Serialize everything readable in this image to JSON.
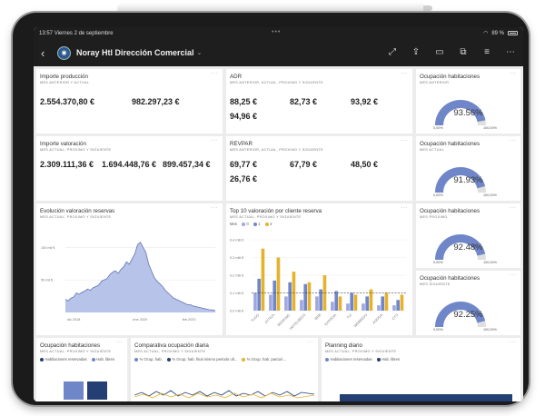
{
  "colors": {
    "accent": "#6f86c9",
    "gold": "#e5b22e",
    "navy": "#233f73",
    "lilac": "#9fa7de",
    "gaugeTrack": "#dfdfdf",
    "area": "#b7c3e8"
  },
  "statusbar": {
    "time": "13:57",
    "date": "Viernes 2 de septiembre",
    "battery": "89 %",
    "handle": "•••"
  },
  "appbar": {
    "title": "Noray Htl Dirección Comercial",
    "icons": [
      "back-icon",
      "expand-icon",
      "share-icon",
      "comment-icon",
      "present-icon",
      "list-icon",
      "more-icon"
    ]
  },
  "cards": {
    "importe_produccion": {
      "title": "Importe producción",
      "sub": "MES ANTERIOR Y ACTUAL",
      "v1": "2.554.370,80 €",
      "v2": "982.297,23 €"
    },
    "adr": {
      "title": "ADR",
      "sub": "MES ANTERIOR, ACTUAL, PROXIMO Y SIGUIENTE",
      "v1": "88,25 €",
      "v2": "82,73 €",
      "v3": "93,92 €",
      "v4": "94,96 €"
    },
    "importe_valoracion": {
      "title": "Importe valoración",
      "sub": "MES ACTUAL, PROXIMO Y SIGUIENTE",
      "v1": "2.309.111,36 €",
      "v2": "1.694.448,76 €",
      "v3": "899.457,34 €"
    },
    "revpar": {
      "title": "REVPAR",
      "sub": "MES ANTERIOR, ACTUAL, PROXIMO Y SIGUIENTE",
      "v1": "69,77 €",
      "v2": "67,79 €",
      "v3": "48,50 €",
      "v4": "26,76 €"
    },
    "ocup_anterior": {
      "title": "Ocupación habitaciones",
      "sub": "MES ANTERIOR",
      "value": "93.56%",
      "fraction": 0.9356,
      "min": "0,00%",
      "max": "100,00%"
    },
    "ocup_actual": {
      "title": "Ocupación habitaciones",
      "sub": "MES ACTUAL",
      "value": "91.93%",
      "fraction": 0.9193,
      "min": "0,00%",
      "max": "100,00%"
    },
    "ocup_proximo": {
      "title": "Ocupación habitaciones",
      "sub": "MES PROXIMO",
      "value": "92.48%",
      "fraction": 0.9248,
      "min": "0,00%",
      "max": "100,00%"
    },
    "ocup_siguiente": {
      "title": "Ocupación habitaciones",
      "sub": "MES SIGUIENTE",
      "value": "92.25%",
      "fraction": 0.9225,
      "min": "0,00%",
      "max": "100,00%"
    },
    "evolucion": {
      "title": "Evolución valoración reservas",
      "sub": "MES ACTUAL, PROXIMO Y SIGUIENTE"
    },
    "top10": {
      "title": "Top 10 valoración por cliente reserva",
      "sub": "MES ACTUAL, PROXIMO Y SIGUIENTE",
      "legend_title": "Mes",
      "legend": [
        "0",
        "1",
        "2"
      ]
    },
    "ocup_stacked": {
      "title": "Ocupación habitaciones",
      "sub": "MES ACTUAL, PROXIMO Y SIGUIENTE",
      "legend": [
        "Habitaciones reservadas",
        "Hab. libres"
      ]
    },
    "comparativa": {
      "title": "Comparativa ocupación diaria",
      "sub": "MES ACTUAL, PROXIMO Y SIGUIENTE",
      "legend": [
        "% Ocup. hab.",
        "% Ocup. hab. final mismo periodo ult...",
        "% Ocup. hab. parcial ..."
      ]
    },
    "planning": {
      "title": "Planning diario",
      "sub": "MES ACTUAL, PROXIMO Y SIGUIENTE",
      "legend": [
        "Habitaciones reservadas",
        "Hab. libres"
      ]
    }
  },
  "chart_data": [
    {
      "type": "area",
      "x_ticks": [
        "dic 2018",
        "ene 2020",
        "feb 2020"
      ],
      "y_ticks": [
        "100 mil €",
        "50 mil €"
      ],
      "ylim": [
        0,
        120
      ],
      "values": [
        20,
        18,
        22,
        24,
        30,
        28,
        31,
        33,
        36,
        34,
        38,
        40,
        42,
        48,
        50,
        52,
        58,
        62,
        64,
        60,
        66,
        70,
        78,
        74,
        82,
        90,
        104,
        108,
        100,
        92,
        74,
        64,
        54,
        48,
        44,
        40,
        34,
        30,
        26,
        22,
        20,
        18,
        16,
        14,
        12,
        12,
        10,
        9,
        8,
        7,
        6,
        5,
        4,
        4,
        3
      ]
    },
    {
      "type": "bar",
      "series_names": [
        "0",
        "1",
        "2"
      ],
      "categories": [
        "TUGO",
        "ATTICA",
        "BOOKING",
        "HOTELBEDS",
        "BRB",
        "EXPEDIA",
        "TUI",
        "WEBBEDS",
        "AGODA",
        "CTS"
      ],
      "series": [
        {
          "name": "0",
          "values": [
            0.1,
            0.09,
            0.08,
            0.06,
            0.08,
            0.05,
            0.04,
            0.04,
            0.03,
            0.03
          ]
        },
        {
          "name": "1",
          "values": [
            0.18,
            0.17,
            0.16,
            0.15,
            0.12,
            0.11,
            0.1,
            0.08,
            0.08,
            0.06
          ]
        },
        {
          "name": "2",
          "values": [
            0.35,
            0.3,
            0.22,
            0.16,
            0.2,
            0.08,
            0.09,
            0.12,
            0.1,
            0.09
          ]
        }
      ],
      "y_ticks": [
        "0,4 mill.€",
        "0,3 mill.€",
        "0,2 mill.€",
        "0,1 mill.€",
        "0,0 mill.€"
      ],
      "ylim": [
        0,
        0.4
      ],
      "reference_line": 0.1
    }
  ]
}
